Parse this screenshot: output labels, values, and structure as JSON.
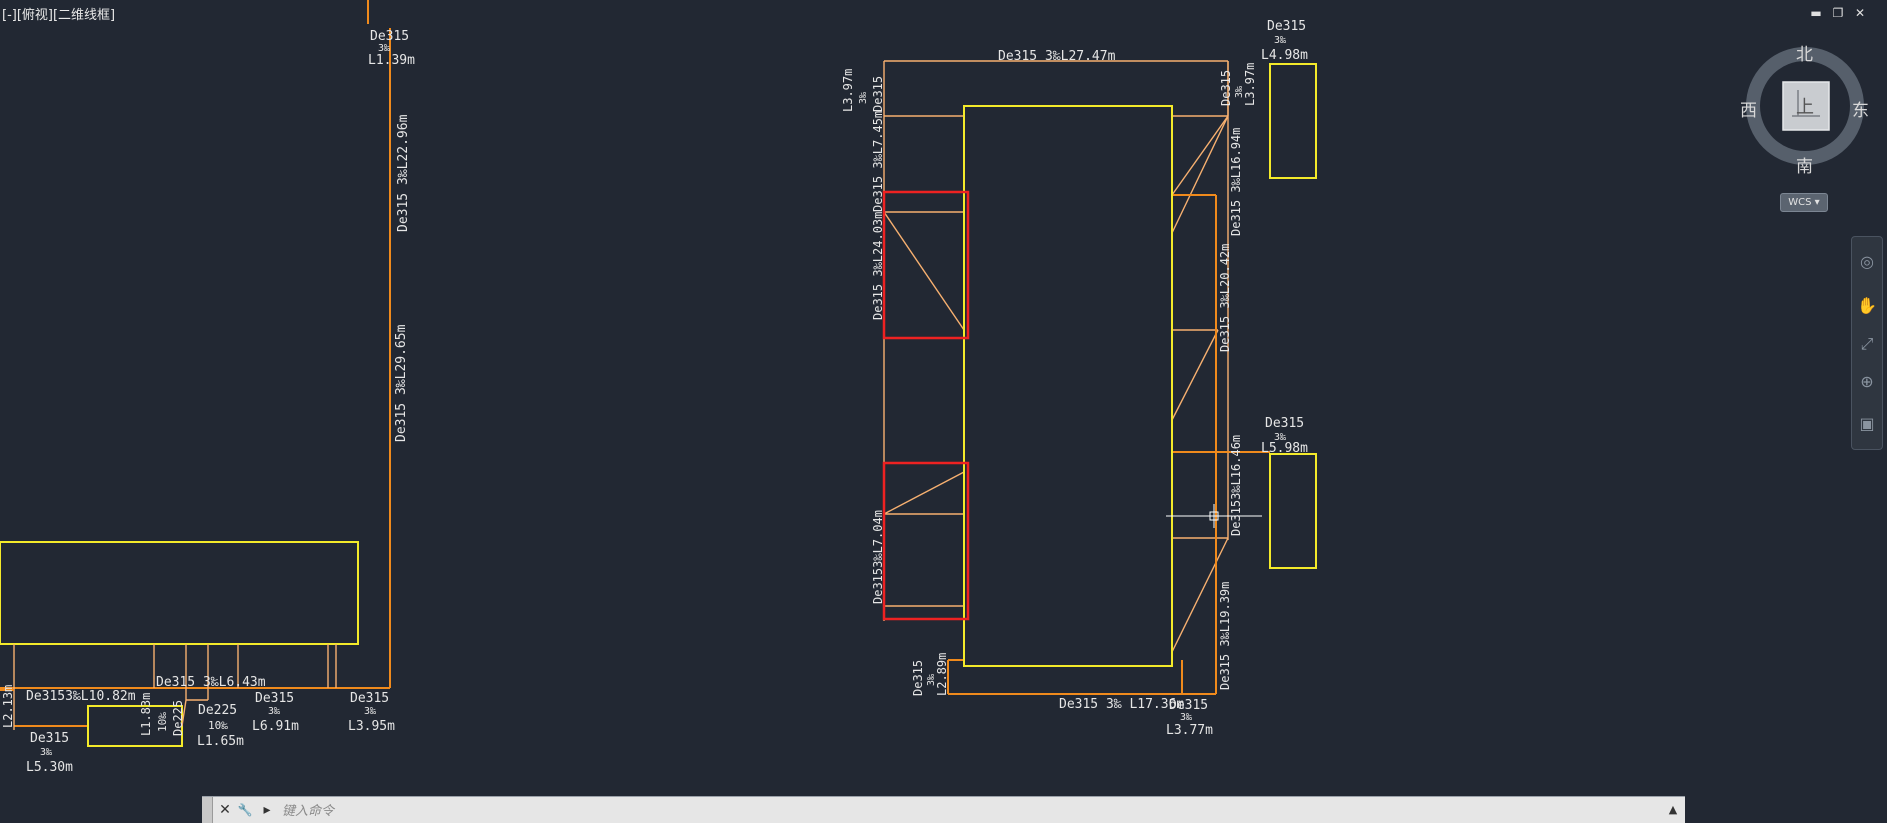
{
  "viewport_label": "[-][俯视][二维线框]",
  "window_controls": {
    "minimize": "▬",
    "restore": "❐",
    "close": "✕"
  },
  "viewcube": {
    "north": "北",
    "south": "南",
    "east": "东",
    "west": "西",
    "face": "上",
    "wcs": "WCS ▾"
  },
  "colors": {
    "background": "#222833",
    "pipe": "#f08a1c",
    "pipe_light": "#f7b070",
    "structure": "#f4ea2a",
    "highlight": "#ee2222",
    "text": "#e6e6e6"
  },
  "command_line": {
    "placeholder": "键入命令",
    "close_icon": "✕",
    "settings_icon": "🔧",
    "prompt_icon": "▸"
  },
  "labels": {
    "l01": "De315",
    "l02": "3‰",
    "l03": "L1.39m",
    "l04": "De315 3‰L22.96m",
    "l05": "De315 3‰L29.65m",
    "l06": "De3153‰L10.82m",
    "l07": "De315 3‰L6.43m",
    "l08": "De315",
    "l09": "3‰",
    "l10": "L6.91m",
    "l11": "De315",
    "l12": "3‰",
    "l13": "L3.95m",
    "l14": "De225",
    "l15": "10‰",
    "l16": "L1.65m",
    "l17": "L1.83m",
    "l18": "10‰",
    "l19": "De225",
    "l20": "De315",
    "l21": "3‰",
    "l22": "L5.30m",
    "l23": "L2.13m",
    "r01": "De315 3‰L27.47m",
    "r02": "L3.97m",
    "r03": "3‰",
    "r04": "De315",
    "r05": "De315 3‰L7.45m",
    "r06": "De315 3‰L24.03m",
    "r07": "De3153‰L7.04m",
    "r08": "De315",
    "r09": "3‰",
    "r10": "L4.98m",
    "r11": "De315",
    "r12": "3‰",
    "r13": "L3.97m",
    "r14": "De315 3‰L16.94m",
    "r15": "De315 3‰L20.42m",
    "r16": "De315",
    "r17": "3‰",
    "r18": "L5.98m",
    "r19": "De3153‰L16.46m",
    "r20": "De315 3‰L19.39m",
    "r21": "De315 3‰ L17.36m",
    "r22": "De315",
    "r23": "3‰",
    "r24": "L3.77m",
    "r25": "De315",
    "r26": "3‰",
    "r27": "L2.89m"
  }
}
